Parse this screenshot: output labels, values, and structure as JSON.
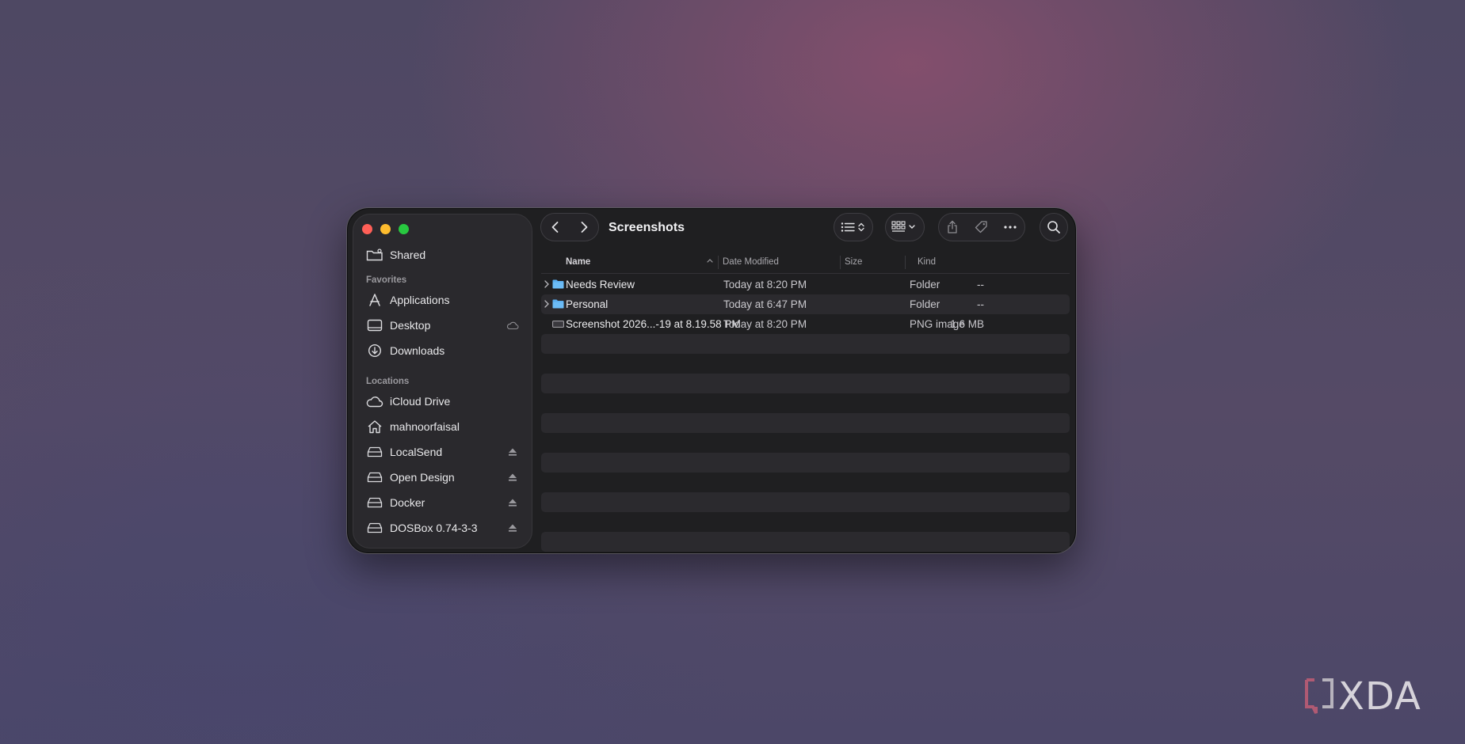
{
  "window": {
    "title": "Screenshots"
  },
  "sidebar": {
    "shared": {
      "label": "Shared",
      "icon": "shared-folder-icon"
    },
    "favorites_header": "Favorites",
    "favorites": [
      {
        "label": "Applications",
        "icon": "applications-icon"
      },
      {
        "label": "Desktop",
        "icon": "desktop-icon",
        "trailing": "icloud-icon"
      },
      {
        "label": "Downloads",
        "icon": "downloads-icon"
      }
    ],
    "locations_header": "Locations",
    "locations": [
      {
        "label": "iCloud Drive",
        "icon": "icloud-drive-icon"
      },
      {
        "label": "mahnoorfaisal",
        "icon": "home-icon"
      },
      {
        "label": "LocalSend",
        "icon": "disk-icon",
        "trailing": "eject-icon"
      },
      {
        "label": "Open Design",
        "icon": "disk-icon",
        "trailing": "eject-icon"
      },
      {
        "label": "Docker",
        "icon": "disk-icon",
        "trailing": "eject-icon"
      },
      {
        "label": "DOSBox 0.74-3-3",
        "icon": "disk-icon",
        "trailing": "eject-icon"
      }
    ]
  },
  "columns": {
    "name": "Name",
    "date": "Date Modified",
    "size": "Size",
    "kind": "Kind"
  },
  "files": [
    {
      "name": "Needs Review",
      "date": "Today at 8:20 PM",
      "size": "--",
      "kind": "Folder",
      "type": "folder"
    },
    {
      "name": "Personal",
      "date": "Today at 6:47 PM",
      "size": "--",
      "kind": "Folder",
      "type": "folder"
    },
    {
      "name": "Screenshot 2026...-19 at 8.19.58 PM",
      "date": "Today at 8:20 PM",
      "size": "1.6 MB",
      "kind": "PNG image",
      "type": "image"
    }
  ],
  "watermark": "XDA",
  "colors": {
    "close": "#ff5f57",
    "minimize": "#febc2e",
    "maximize": "#28c840",
    "folder": "#5aaef0"
  }
}
